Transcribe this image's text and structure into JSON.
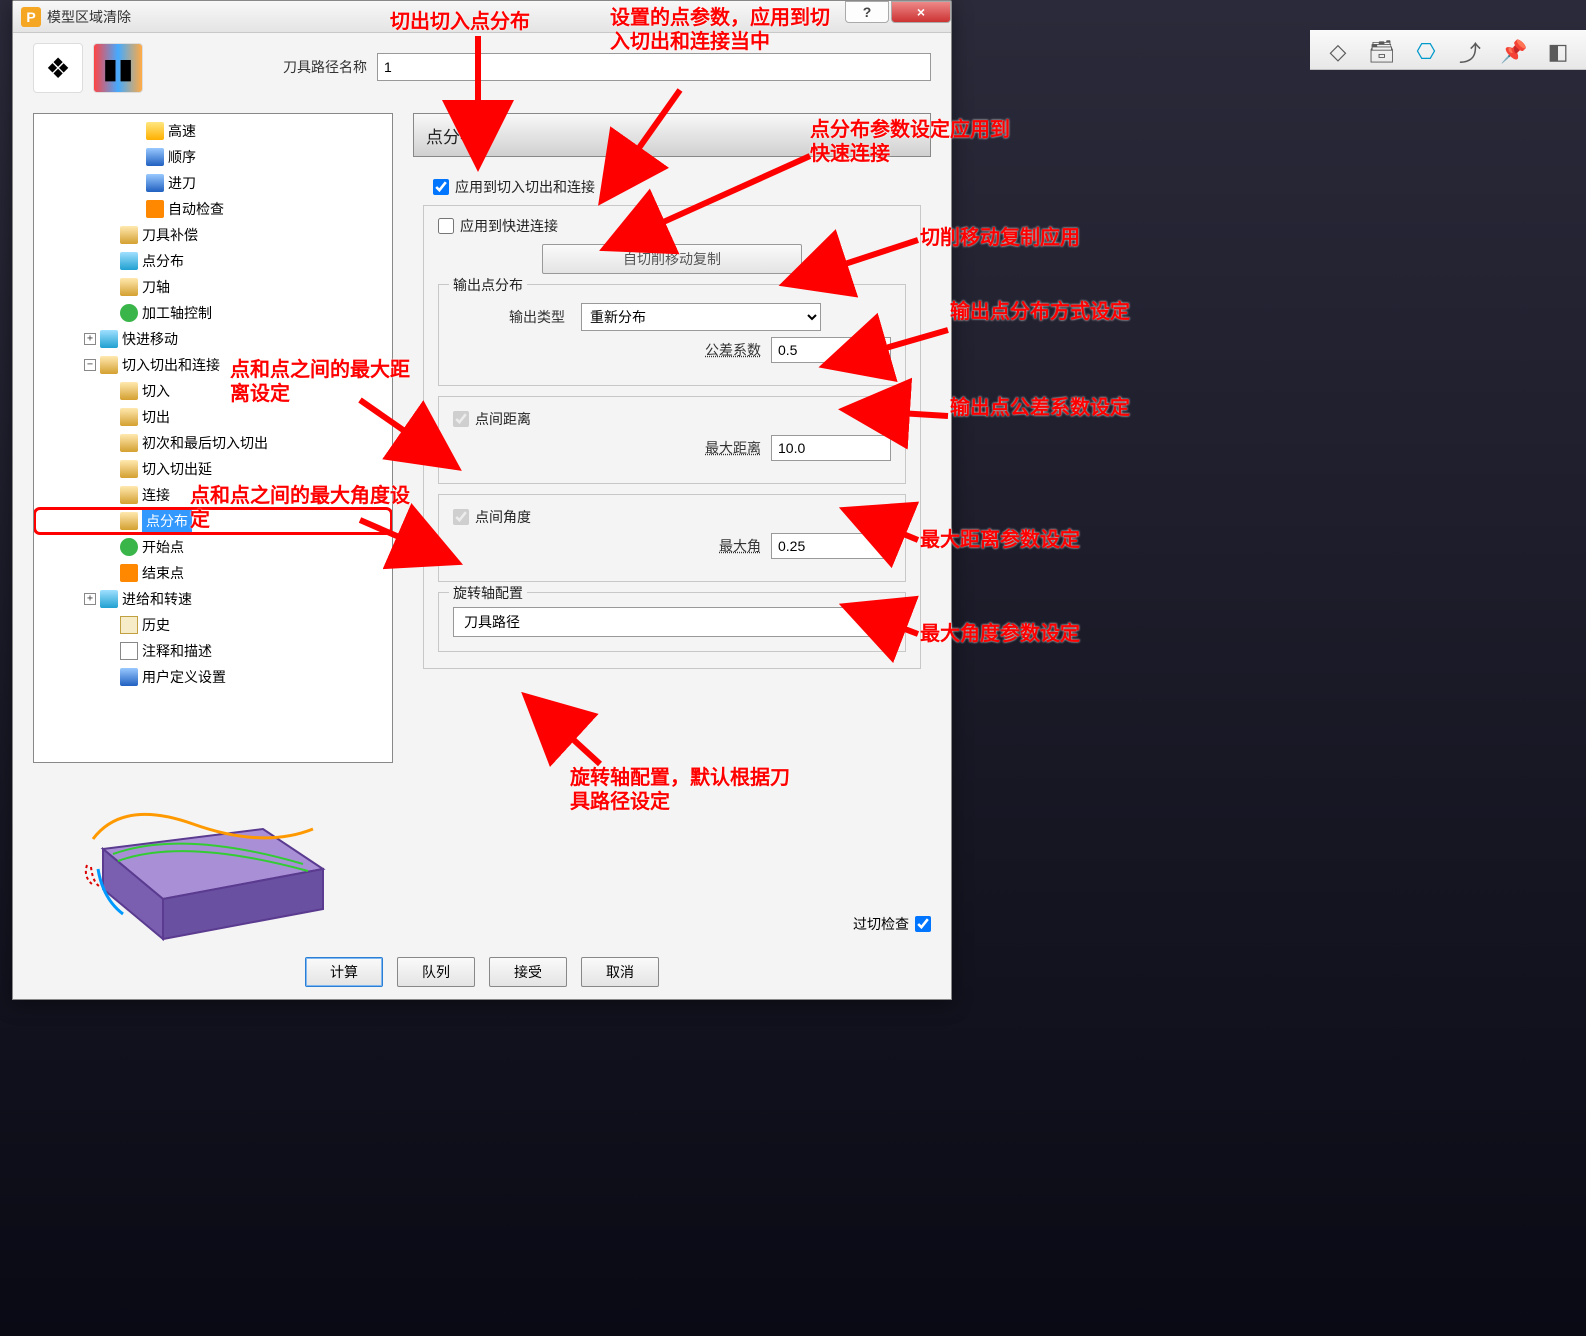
{
  "dialog": {
    "title": "模型区域清除",
    "app_letter": "P",
    "help_symbol": "?",
    "close_symbol": "×"
  },
  "name_row": {
    "label": "刀具路径名称",
    "value": "1"
  },
  "tree": {
    "items": [
      {
        "level": 3,
        "exp": "",
        "icon": "ic-yellow",
        "label": "高速"
      },
      {
        "level": 3,
        "exp": "",
        "icon": "ic-blue",
        "label": "顺序"
      },
      {
        "level": 3,
        "exp": "",
        "icon": "ic-blue",
        "label": "进刀"
      },
      {
        "level": 3,
        "exp": "",
        "icon": "ic-orange",
        "label": "自动检查"
      },
      {
        "level": 2,
        "exp": "",
        "icon": "ic-gold",
        "label": "刀具补偿"
      },
      {
        "level": 2,
        "exp": "",
        "icon": "ic-cyan",
        "label": "点分布"
      },
      {
        "level": 2,
        "exp": "",
        "icon": "ic-gold",
        "label": "刀轴"
      },
      {
        "level": 2,
        "exp": "",
        "icon": "ic-green",
        "label": "加工轴控制"
      },
      {
        "level": 1,
        "exp": "+",
        "icon": "ic-cyan",
        "label": "快进移动"
      },
      {
        "level": 1,
        "exp": "−",
        "icon": "ic-gold",
        "label": "切入切出和连接"
      },
      {
        "level": 2,
        "exp": "",
        "icon": "ic-gold",
        "label": "切入"
      },
      {
        "level": 2,
        "exp": "",
        "icon": "ic-gold",
        "label": "切出"
      },
      {
        "level": 2,
        "exp": "",
        "icon": "ic-gold",
        "label": "初次和最后切入切出"
      },
      {
        "level": 2,
        "exp": "",
        "icon": "ic-gold",
        "label": "切入切出延"
      },
      {
        "level": 2,
        "exp": "",
        "icon": "ic-gold",
        "label": "连接"
      },
      {
        "level": 2,
        "exp": "",
        "icon": "ic-gold",
        "label": "点分布",
        "selected": true
      },
      {
        "level": 2,
        "exp": "",
        "icon": "ic-green",
        "label": "开始点"
      },
      {
        "level": 2,
        "exp": "",
        "icon": "ic-orange",
        "label": "结束点"
      },
      {
        "level": 1,
        "exp": "+",
        "icon": "ic-cyan",
        "label": "进给和转速"
      },
      {
        "level": 2,
        "exp": "",
        "icon": "ic-scroll",
        "label": "历史"
      },
      {
        "level": 2,
        "exp": "",
        "icon": "ic-doc",
        "label": "注释和描述"
      },
      {
        "level": 2,
        "exp": "",
        "icon": "ic-blue",
        "label": "用户定义设置"
      }
    ]
  },
  "section_title": "点分布",
  "checkboxes": {
    "apply_leadlink": {
      "label": "应用到切入切出和连接",
      "checked": true
    },
    "apply_rapid": {
      "label": "应用到快进连接",
      "checked": false
    }
  },
  "copy_btn": "自切削移动复制",
  "output_group": {
    "title": "输出点分布",
    "type_label": "输出类型",
    "type_value": "重新分布",
    "tol_label": "公差系数",
    "tol_value": "0.5"
  },
  "dist_group": {
    "chk_label": "点间距离",
    "chk_checked": true,
    "max_label": "最大距离",
    "max_value": "10.0"
  },
  "angle_group": {
    "chk_label": "点间角度",
    "chk_checked": true,
    "max_label": "最大角",
    "max_value": "0.25"
  },
  "rotary_group": {
    "title": "旋转轴配置",
    "value": "刀具路径"
  },
  "overshoot": {
    "label": "过切检查",
    "checked": true
  },
  "buttons": {
    "calc": "计算",
    "queue": "队列",
    "accept": "接受",
    "cancel": "取消"
  },
  "annotations": {
    "a1": "切出切入点分布",
    "a2": "设置的点参数，应用到切入切出和连接当中",
    "a3": "点分布参数设定应用到快速连接",
    "a4": "切削移动复制应用",
    "a5": "输出点分布方式设定",
    "a6": "输出点公差系数设定",
    "a7": "最大距离参数设定",
    "a8": "最大角度参数设定",
    "a9": "点和点之间的最大距离设定",
    "a10": "点和点之间的最大角度设定",
    "a11": "旋转轴配置，默认根据刀具路径设定"
  }
}
